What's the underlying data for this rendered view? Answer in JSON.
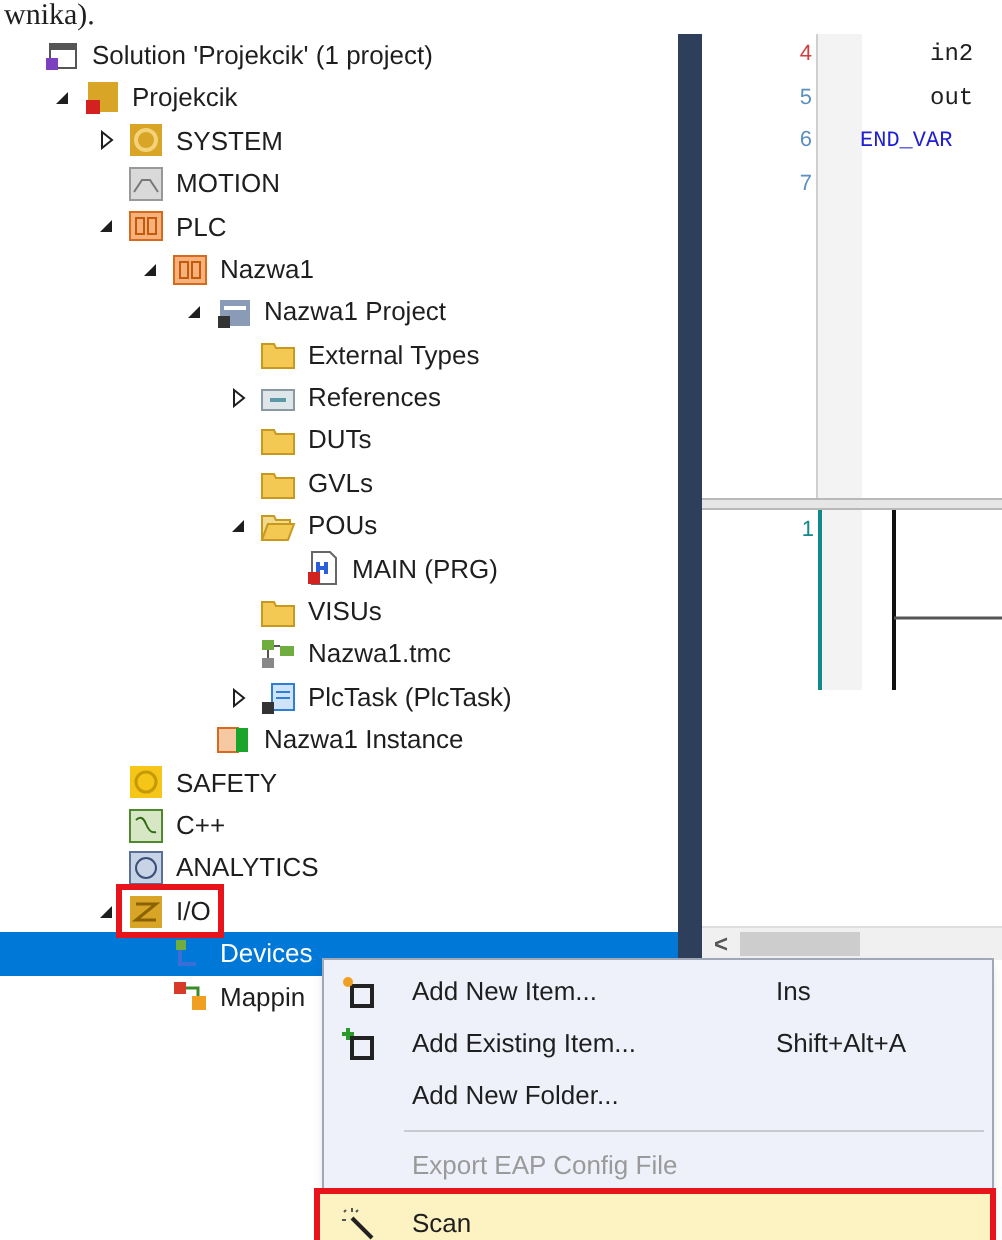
{
  "caption_fragment": "wnika).",
  "solution_explorer": {
    "tree": [
      {
        "label": "Solution 'Projekcik' (1 project)",
        "kind": "solution",
        "children": [
          {
            "label": "Projekcik",
            "kind": "project",
            "expanded": true,
            "children": [
              {
                "label": "SYSTEM",
                "kind": "system",
                "expanded": false
              },
              {
                "label": "MOTION",
                "kind": "motion"
              },
              {
                "label": "PLC",
                "kind": "plc",
                "expanded": true,
                "children": [
                  {
                    "label": "Nazwa1",
                    "kind": "plc",
                    "expanded": true,
                    "children": [
                      {
                        "label": "Nazwa1 Project",
                        "kind": "plcproject",
                        "expanded": true,
                        "children": [
                          {
                            "label": "External Types",
                            "kind": "folder"
                          },
                          {
                            "label": "References",
                            "kind": "references",
                            "expanded": false
                          },
                          {
                            "label": "DUTs",
                            "kind": "folder"
                          },
                          {
                            "label": "GVLs",
                            "kind": "folder"
                          },
                          {
                            "label": "POUs",
                            "kind": "folderopen",
                            "expanded": true,
                            "children": [
                              {
                                "label": "MAIN (PRG)",
                                "kind": "pou"
                              }
                            ]
                          },
                          {
                            "label": "VISUs",
                            "kind": "folder"
                          },
                          {
                            "label": "Nazwa1.tmc",
                            "kind": "tmc"
                          },
                          {
                            "label": "PlcTask (PlcTask)",
                            "kind": "task",
                            "expanded": false
                          }
                        ]
                      },
                      {
                        "label": "Nazwa1 Instance",
                        "kind": "instance"
                      }
                    ]
                  }
                ]
              },
              {
                "label": "SAFETY",
                "kind": "safety"
              },
              {
                "label": "C++",
                "kind": "cpp"
              },
              {
                "label": "ANALYTICS",
                "kind": "analytics"
              },
              {
                "label": "I/O",
                "kind": "io",
                "expanded": true,
                "highlighted": true,
                "children": [
                  {
                    "label": "Devices",
                    "kind": "devices",
                    "selected": true
                  },
                  {
                    "label": "Mappin",
                    "kind": "mappings",
                    "selected": false
                  }
                ]
              }
            ]
          }
        ]
      }
    ]
  },
  "editor": {
    "lines": [
      {
        "number": "4",
        "code": "in2",
        "kind": "var",
        "modified": true
      },
      {
        "number": "5",
        "code": "out",
        "kind": "var",
        "modified": false
      },
      {
        "number": "6",
        "code": "END_VAR",
        "kind": "keyword",
        "modified": false
      },
      {
        "number": "7",
        "kind": "empty",
        "modified": false
      }
    ],
    "ladder_line": "1",
    "scroll_left": "<"
  },
  "context_menu": {
    "items": [
      {
        "kind": "item",
        "label": "Add New Item...",
        "shortcut": "Ins",
        "disabled": false,
        "highlighted": false
      },
      {
        "kind": "item",
        "label": "Add Existing Item...",
        "shortcut": "Shift+Alt+A",
        "disabled": false,
        "highlighted": false
      },
      {
        "kind": "item",
        "label": "Add New Folder...",
        "disabled": false,
        "highlighted": false
      },
      {
        "kind": "separator"
      },
      {
        "kind": "item",
        "label": "Export EAP Config File",
        "disabled": true,
        "highlighted": false
      },
      {
        "kind": "item",
        "label": "Scan",
        "disabled": false,
        "highlighted": true
      }
    ]
  }
}
